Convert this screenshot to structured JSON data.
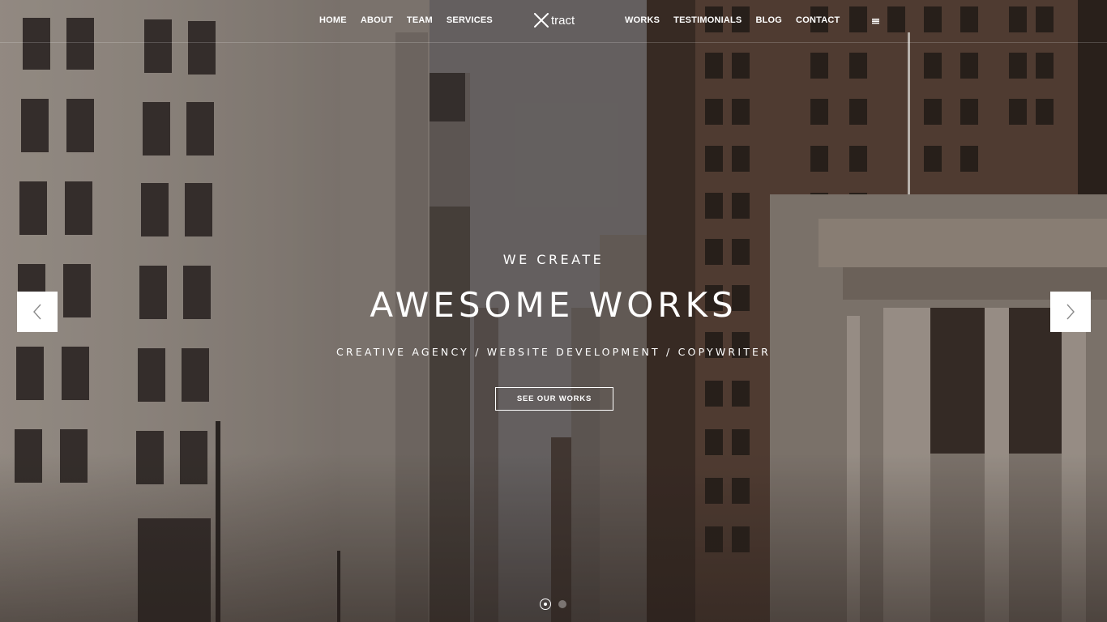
{
  "nav": {
    "left_items": [
      {
        "label": "HOME"
      },
      {
        "label": "ABOUT"
      },
      {
        "label": "TEAM"
      },
      {
        "label": "SERVICES"
      }
    ],
    "right_items": [
      {
        "label": "WORKS"
      },
      {
        "label": "TESTIMONIALS"
      },
      {
        "label": "BLOG"
      },
      {
        "label": "CONTACT"
      }
    ],
    "menu_icon": "hamburger-menu-icon"
  },
  "logo": {
    "text": "tract",
    "mark_icon": "x-logo-icon"
  },
  "hero": {
    "eyebrow": "WE CREATE",
    "headline": "AWESOME WORKS",
    "subline": "CREATIVE AGENCY / WEBSITE DEVELOPMENT / COPYWRITER",
    "cta_label": "SEE OUR WORKS"
  },
  "slider": {
    "prev_icon": "chevron-left-icon",
    "next_icon": "chevron-right-icon",
    "slide_count": 2,
    "active_slide": 1
  },
  "colors": {
    "text": "#ffffff",
    "arrow_bg": "#ffffff",
    "arrow_icon": "#8a8a8a"
  }
}
